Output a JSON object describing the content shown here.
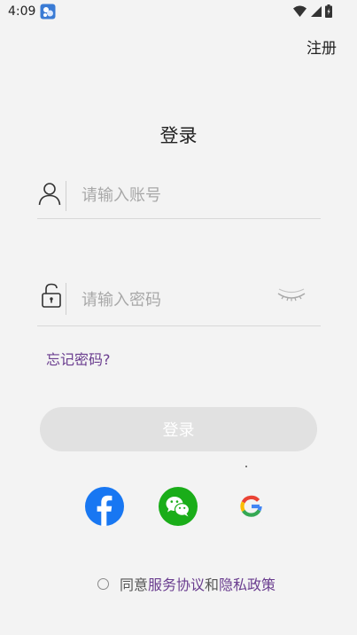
{
  "status_bar": {
    "time": "4:09",
    "icons": [
      "app-notification-icon",
      "wifi-icon",
      "cellular-signal-icon",
      "battery-icon"
    ]
  },
  "header": {
    "register_label": "注册"
  },
  "title": "登录",
  "account_field": {
    "placeholder": "请输入账号",
    "value": "",
    "icon": "user-icon"
  },
  "password_field": {
    "placeholder": "请输入密码",
    "value": "",
    "icon": "unlock-icon",
    "toggle_icon": "eye-closed-icon"
  },
  "forgot_password_label": "忘记密码?",
  "login_button_label": "登录",
  "social_login": [
    {
      "name": "facebook",
      "icon": "facebook-icon",
      "color": "#1877F2"
    },
    {
      "name": "wechat",
      "icon": "wechat-icon",
      "color": "#1AAD19"
    },
    {
      "name": "google",
      "icon": "google-icon",
      "color": "#4285F4"
    }
  ],
  "agreement": {
    "prefix": "同意",
    "terms_label": "服务协议",
    "connector": "和",
    "privacy_label": "隐私政策",
    "checked": false
  },
  "colors": {
    "background": "#f3f3f3",
    "link": "#6a3d8f",
    "button_disabled": "#e1e1e1",
    "placeholder": "#a8a8a8"
  }
}
